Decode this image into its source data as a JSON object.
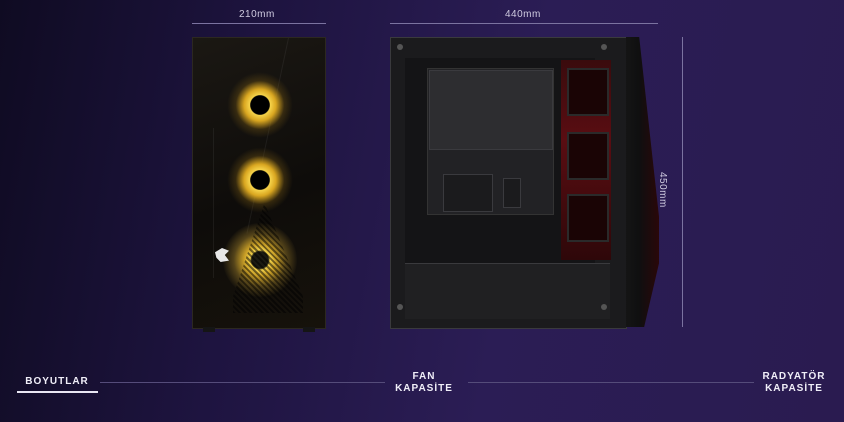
{
  "dimensions": {
    "width_front": "210mm",
    "length_side": "440mm",
    "height": "450mm"
  },
  "tabs": [
    {
      "line1": "BOYUTLAR",
      "line2": "",
      "active": true
    },
    {
      "line1": "FAN",
      "line2": "KAPASİTE",
      "active": false
    },
    {
      "line1": "RADYATÖR",
      "line2": "KAPASİTE",
      "active": false
    }
  ],
  "colors": {
    "fan_glow": "#f4c430",
    "accent_red": "#8a0f16",
    "background": "#1e1440"
  },
  "icons": [
    "corsair-logo-icon"
  ]
}
